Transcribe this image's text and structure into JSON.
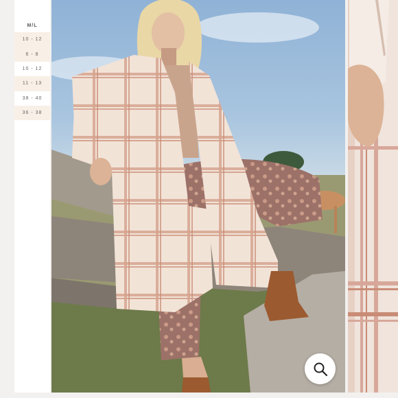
{
  "size_chart": {
    "heading": "M/L",
    "rows": [
      "10 - 12",
      "6 - 8",
      "10 - 12",
      "11 - 13",
      "38 - 40",
      "36 - 38"
    ]
  },
  "main_image": {
    "icon": "model-photo"
  },
  "side_image": {
    "icon": "fabric-closeup-photo"
  },
  "zoom": {
    "icon": "search-icon"
  },
  "colors": {
    "panel_background": "#ffffff",
    "row_shade": "#f8efe6",
    "coat": "#f1e2d6",
    "plaid": "#c98c76",
    "pants": "#9c7168",
    "boots": "#9b5a2f"
  }
}
